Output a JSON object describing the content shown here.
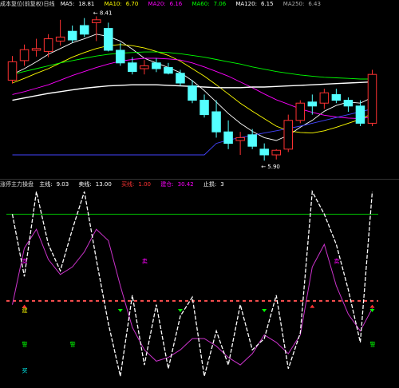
{
  "top_info": {
    "title": "成本复位(前复权)日线",
    "items": [
      {
        "label": "MA5:",
        "value": "18.81",
        "color": "#ffffff"
      },
      {
        "label": "MA10:",
        "value": "6.70",
        "color": "#ffff00"
      },
      {
        "label": "MA20:",
        "value": "6.16",
        "color": "#ff00ff"
      },
      {
        "label": "MA60:",
        "value": "7.06",
        "color": "#00ff00"
      },
      {
        "label": "MA120:",
        "value": "6.15",
        "color": "#ffffff"
      },
      {
        "label": "MA250:",
        "value": "6.43",
        "color": "#aaaaaa"
      }
    ]
  },
  "price_labels": {
    "high_price": "8.41",
    "low_price": "5.90"
  },
  "bottom_info": {
    "title": "涨停主力操盘",
    "items": [
      {
        "label": "主线:",
        "value": "9.03",
        "color": "#ffffff"
      },
      {
        "label": "卖线:",
        "value": "13.00",
        "color": "#ffffff"
      },
      {
        "label": "买线:",
        "value": "1.00",
        "color": "#ff0000"
      },
      {
        "label": "建仓:",
        "value": "30.42",
        "color": "#ff00ff"
      },
      {
        "label": "止损:",
        "value": "3",
        "color": "#ffffff"
      }
    ]
  },
  "indicator_markers": {
    "sell": "卖",
    "buy": "买",
    "warn": "警",
    "build": "建"
  },
  "colors": {
    "up": "#ff3232",
    "down": "#54ffff",
    "ma5": "#ffffff",
    "ma10": "#ffff00",
    "ma20": "#ff00ff",
    "ma60": "#00ff00",
    "ma120": "#ffffff",
    "ma250": "#4444ff"
  },
  "chart_data": [
    {
      "type": "candlestick",
      "candles": [
        {
          "o": 7.3,
          "h": 7.72,
          "l": 7.24,
          "c": 7.62
        },
        {
          "o": 7.64,
          "h": 7.92,
          "l": 7.55,
          "c": 7.83
        },
        {
          "o": 7.82,
          "h": 8.02,
          "l": 7.71,
          "c": 7.85
        },
        {
          "o": 7.8,
          "h": 8.1,
          "l": 7.7,
          "c": 8.02
        },
        {
          "o": 7.98,
          "h": 8.35,
          "l": 7.9,
          "c": 8.05
        },
        {
          "o": 8.15,
          "h": 8.25,
          "l": 7.95,
          "c": 8.0
        },
        {
          "o": 8.25,
          "h": 8.38,
          "l": 8.05,
          "c": 8.1
        },
        {
          "o": 8.3,
          "h": 8.41,
          "l": 7.98,
          "c": 8.35
        },
        {
          "o": 8.2,
          "h": 8.3,
          "l": 7.8,
          "c": 7.82
        },
        {
          "o": 7.82,
          "h": 7.95,
          "l": 7.55,
          "c": 7.6
        },
        {
          "o": 7.6,
          "h": 7.7,
          "l": 7.4,
          "c": 7.45
        },
        {
          "o": 7.5,
          "h": 7.65,
          "l": 7.4,
          "c": 7.55
        },
        {
          "o": 7.6,
          "h": 7.68,
          "l": 7.44,
          "c": 7.5
        },
        {
          "o": 7.52,
          "h": 7.6,
          "l": 7.4,
          "c": 7.42
        },
        {
          "o": 7.42,
          "h": 7.48,
          "l": 7.2,
          "c": 7.25
        },
        {
          "o": 7.2,
          "h": 7.3,
          "l": 6.9,
          "c": 6.95
        },
        {
          "o": 6.95,
          "h": 7.05,
          "l": 6.65,
          "c": 6.7
        },
        {
          "o": 6.75,
          "h": 6.95,
          "l": 6.3,
          "c": 6.4
        },
        {
          "o": 6.4,
          "h": 6.6,
          "l": 6.1,
          "c": 6.2
        },
        {
          "o": 6.25,
          "h": 6.4,
          "l": 6.0,
          "c": 6.3
        },
        {
          "o": 6.35,
          "h": 6.45,
          "l": 6.1,
          "c": 6.15
        },
        {
          "o": 6.1,
          "h": 6.2,
          "l": 5.9,
          "c": 6.0
        },
        {
          "o": 6.0,
          "h": 6.1,
          "l": 5.92,
          "c": 6.08
        },
        {
          "o": 6.1,
          "h": 6.7,
          "l": 6.05,
          "c": 6.6
        },
        {
          "o": 6.6,
          "h": 6.95,
          "l": 6.55,
          "c": 6.9
        },
        {
          "o": 6.92,
          "h": 7.05,
          "l": 6.7,
          "c": 6.85
        },
        {
          "o": 6.9,
          "h": 7.15,
          "l": 6.8,
          "c": 7.08
        },
        {
          "o": 7.05,
          "h": 7.15,
          "l": 6.9,
          "c": 6.95
        },
        {
          "o": 6.95,
          "h": 7.0,
          "l": 6.75,
          "c": 6.85
        },
        {
          "o": 6.85,
          "h": 6.95,
          "l": 6.5,
          "c": 6.55
        },
        {
          "o": 6.55,
          "h": 7.48,
          "l": 6.5,
          "c": 7.4
        }
      ],
      "series": [
        {
          "name": "MA5",
          "values": [
            7.4,
            7.5,
            7.62,
            7.75,
            7.85,
            7.95,
            8.02,
            8.1,
            8.06,
            7.98,
            7.84,
            7.68,
            7.6,
            7.52,
            7.43,
            7.29,
            7.12,
            6.92,
            6.72,
            6.55,
            6.41,
            6.3,
            6.25,
            6.34,
            6.48,
            6.6,
            6.76,
            6.86,
            6.92,
            6.9,
            7.0
          ]
        },
        {
          "name": "MA10",
          "values": [
            7.25,
            7.33,
            7.42,
            7.5,
            7.6,
            7.7,
            7.78,
            7.85,
            7.9,
            7.92,
            7.9,
            7.86,
            7.8,
            7.73,
            7.63,
            7.5,
            7.37,
            7.22,
            7.06,
            6.9,
            6.76,
            6.63,
            6.5,
            6.42,
            6.39,
            6.38,
            6.42,
            6.48,
            6.55,
            6.62,
            6.72
          ]
        },
        {
          "name": "MA20",
          "values": [
            7.05,
            7.1,
            7.16,
            7.22,
            7.3,
            7.38,
            7.45,
            7.52,
            7.58,
            7.63,
            7.66,
            7.68,
            7.68,
            7.67,
            7.65,
            7.6,
            7.53,
            7.45,
            7.37,
            7.27,
            7.17,
            7.06,
            6.96,
            6.88,
            6.8,
            6.74,
            6.69,
            6.66,
            6.64,
            6.63,
            6.66
          ]
        },
        {
          "name": "MA60",
          "values": [
            7.4,
            7.45,
            7.5,
            7.55,
            7.6,
            7.64,
            7.68,
            7.72,
            7.75,
            7.77,
            7.78,
            7.79,
            7.79,
            7.78,
            7.76,
            7.73,
            7.7,
            7.66,
            7.62,
            7.58,
            7.53,
            7.49,
            7.45,
            7.42,
            7.39,
            7.37,
            7.35,
            7.34,
            7.33,
            7.32,
            7.32
          ]
        },
        {
          "name": "MA120",
          "values": [
            6.95,
            6.99,
            7.03,
            7.07,
            7.1,
            7.13,
            7.16,
            7.18,
            7.2,
            7.21,
            7.22,
            7.22,
            7.22,
            7.21,
            7.2,
            7.19,
            7.18,
            7.17,
            7.17,
            7.17,
            7.18,
            7.18,
            7.19,
            7.2,
            7.21,
            7.22,
            7.23,
            7.24,
            7.25,
            7.26,
            7.27
          ]
        },
        {
          "name": "MA250",
          "values": [
            6.0,
            6.0,
            6.0,
            6.0,
            6.0,
            6.0,
            6.0,
            6.0,
            6.0,
            6.0,
            6.0,
            6.0,
            6.0,
            6.0,
            6.0,
            6.0,
            6.0,
            6.2,
            6.26,
            6.3,
            6.34,
            6.38,
            6.42,
            6.46,
            6.5,
            6.55,
            6.6,
            6.65,
            6.7,
            6.75,
            6.8
          ]
        }
      ],
      "ylim": [
        5.75,
        8.5
      ]
    },
    {
      "type": "line",
      "series": [
        {
          "name": "主线",
          "values": [
            88,
            55,
            100,
            72,
            58,
            80,
            100,
            64,
            30,
            2,
            45,
            8,
            40,
            6,
            34,
            44,
            2,
            26,
            8,
            40,
            16,
            22,
            45,
            6,
            25,
            100,
            88,
            72,
            48,
            20,
            100
          ]
        },
        {
          "name": "建仓",
          "values": [
            40,
            70,
            80,
            64,
            56,
            60,
            68,
            80,
            74,
            50,
            28,
            16,
            10,
            12,
            16,
            22,
            22,
            18,
            12,
            8,
            14,
            24,
            20,
            14,
            24,
            60,
            72,
            50,
            35,
            26,
            38
          ]
        },
        {
          "name": "卖线",
          "values": [
            88,
            88,
            88,
            88,
            88,
            88,
            88,
            88,
            88,
            88,
            88,
            88,
            88,
            88,
            88,
            88,
            88,
            88,
            88,
            88,
            88,
            88,
            88,
            88,
            88,
            88,
            88,
            88,
            88,
            88,
            88
          ]
        },
        {
          "name": "买线",
          "values": [
            42,
            42,
            42,
            42,
            42,
            42,
            42,
            42,
            42,
            42,
            42,
            42,
            42,
            42,
            42,
            42,
            42,
            42,
            42,
            42,
            42,
            42,
            42,
            42,
            42,
            42,
            42,
            42,
            42,
            42,
            42
          ]
        }
      ],
      "ylim": [
        0,
        100
      ]
    }
  ]
}
